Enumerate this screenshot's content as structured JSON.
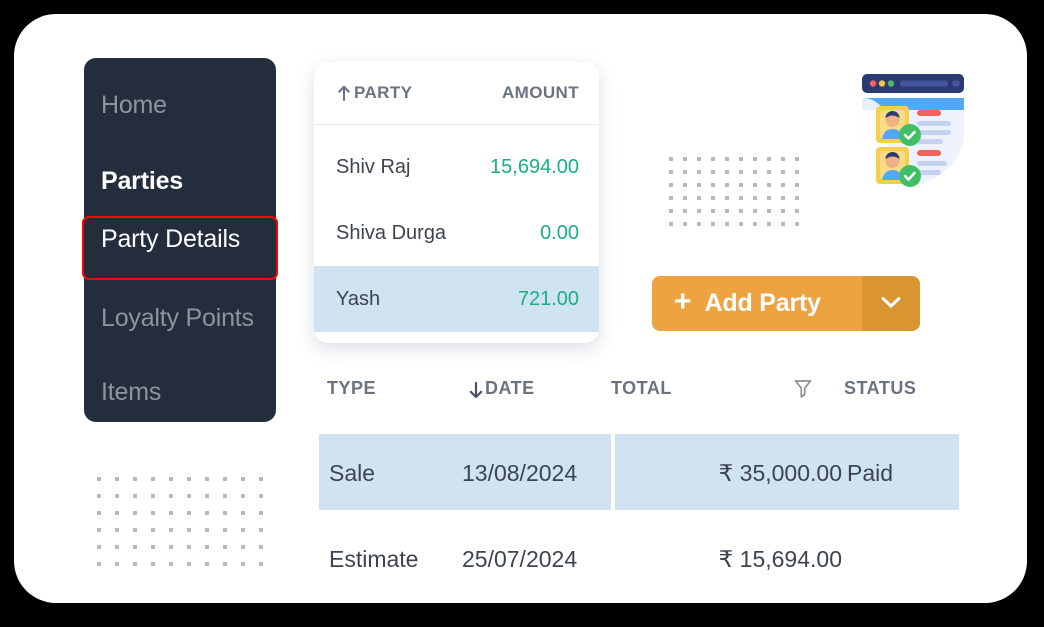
{
  "sidebar": {
    "items": [
      {
        "label": "Home",
        "state": "dim"
      },
      {
        "label": "Parties",
        "state": "bright"
      },
      {
        "label": "Party Details",
        "state": "active"
      },
      {
        "label": "Loyalty Points",
        "state": "dim"
      },
      {
        "label": "Items",
        "state": "dim"
      }
    ],
    "background_color": "#242d3c",
    "focus_border_color": "#ff0000"
  },
  "party_card": {
    "columns": [
      {
        "label": "PARTY",
        "sort_icon": "sort-ascending-arrow-icon"
      },
      {
        "label": "AMOUNT",
        "sort_icon": ""
      }
    ],
    "rows": [
      {
        "name": "Shiv Raj",
        "amount": "15,694.00",
        "selected": false
      },
      {
        "name": "Shiva Durga",
        "amount": "0.00",
        "selected": false
      },
      {
        "name": "Yash",
        "amount": "721.00",
        "selected": true
      }
    ],
    "amount_color": "#18b181",
    "selected_row_color": "#cfe3f2"
  },
  "add_party_button": {
    "plus_icon": "plus-icon",
    "label": "Add Party",
    "caret_icon": "chevron-down-icon",
    "main_color": "#eda33f",
    "caret_color": "#d9952f"
  },
  "transactions": {
    "columns": [
      {
        "label": "TYPE",
        "icon": ""
      },
      {
        "label": "DATE",
        "icon": "sort-descending-arrow-icon"
      },
      {
        "label": "TOTAL",
        "icon": ""
      },
      {
        "label": "",
        "icon": "filter-funnel-icon"
      },
      {
        "label": "STATUS",
        "icon": ""
      }
    ],
    "rows": [
      {
        "type": "Sale",
        "date": "13/08/2024",
        "total": "₹ 35,000.00",
        "status": "Paid",
        "selected": true
      },
      {
        "type": "Estimate",
        "date": "25/07/2024",
        "total": "₹ 15,694.00",
        "status": "",
        "selected": false
      }
    ],
    "selected_row_color": "#cfe3f2"
  },
  "illustration": {
    "name": "user-verification-shield-illustration",
    "browser_bar_color": "#2b3a72",
    "dot_colors": [
      "#f4625c",
      "#f5c443",
      "#4cba6a"
    ],
    "shield_color": "#dfe6f8",
    "badge_color": "#3fc065",
    "avatar_card_color": "#f7cf4e"
  },
  "decorations": {
    "dot_grid_color": "#b9b9bc",
    "dot_grid_columns": 10,
    "dot_grid_rows": 6
  }
}
